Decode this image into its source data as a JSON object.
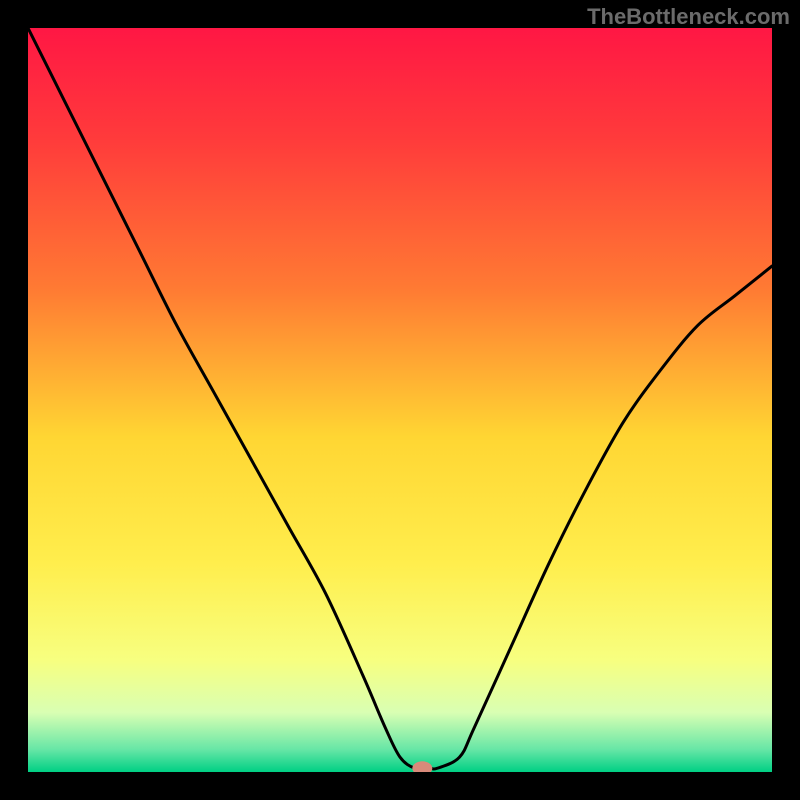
{
  "watermark": "TheBottleneck.com",
  "chart_data": {
    "type": "line",
    "title": "",
    "xlabel": "",
    "ylabel": "",
    "xlim": [
      0,
      100
    ],
    "ylim": [
      0,
      100
    ],
    "series": [
      {
        "name": "curve",
        "x": [
          0,
          5,
          10,
          15,
          20,
          25,
          30,
          35,
          40,
          45,
          48,
          50,
          52,
          54,
          55,
          58,
          60,
          65,
          70,
          75,
          80,
          85,
          90,
          95,
          100
        ],
        "y": [
          100,
          90,
          80,
          70,
          60,
          51,
          42,
          33,
          24,
          13,
          6,
          2,
          0.5,
          0.5,
          0.5,
          2,
          6,
          17,
          28,
          38,
          47,
          54,
          60,
          64,
          68
        ]
      }
    ],
    "marker": {
      "x": 53,
      "y": 0.5
    },
    "gradient_stops": [
      {
        "offset": 0.0,
        "color": "#ff1744"
      },
      {
        "offset": 0.15,
        "color": "#ff3b3b"
      },
      {
        "offset": 0.35,
        "color": "#ff7a33"
      },
      {
        "offset": 0.55,
        "color": "#ffd633"
      },
      {
        "offset": 0.72,
        "color": "#ffee4d"
      },
      {
        "offset": 0.85,
        "color": "#f7ff80"
      },
      {
        "offset": 0.92,
        "color": "#d9ffb3"
      },
      {
        "offset": 0.97,
        "color": "#66e6a6"
      },
      {
        "offset": 1.0,
        "color": "#00d084"
      }
    ]
  }
}
